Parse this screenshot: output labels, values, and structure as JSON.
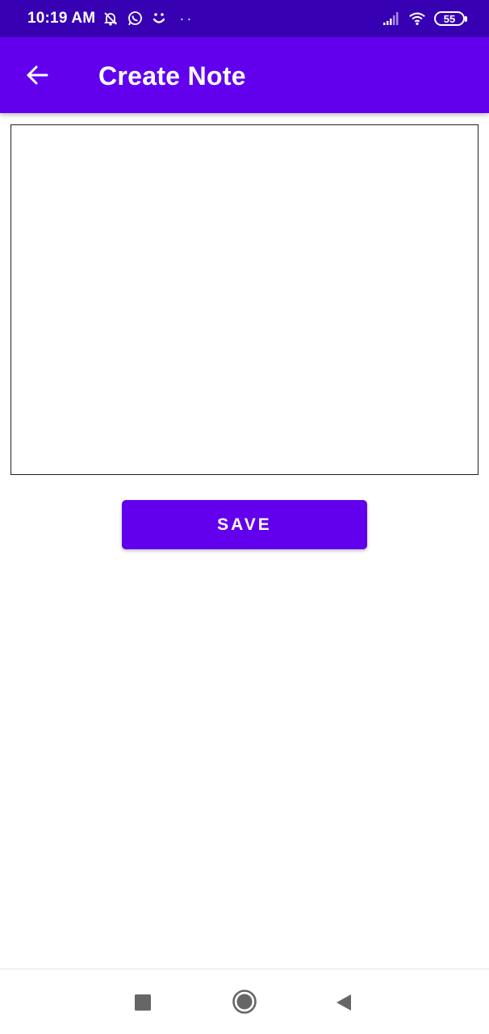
{
  "status_bar": {
    "time": "10:19 AM",
    "battery": "55",
    "icons": [
      "notifications-off-icon",
      "whatsapp-icon",
      "loading-icon",
      "more-dots-icon",
      "signal-icon",
      "wifi-icon",
      "battery-icon"
    ]
  },
  "app_bar": {
    "title": "Create Note",
    "back_icon": "arrow-left-icon"
  },
  "editor": {
    "value": "",
    "placeholder": ""
  },
  "actions": {
    "save_label": "SAVE"
  },
  "nav_bar": {
    "icons": [
      "recents-icon",
      "home-icon",
      "back-icon"
    ]
  },
  "colors": {
    "status_bar": "#3700b3",
    "primary": "#6200ee",
    "on_primary": "#ffffff",
    "background": "#ffffff",
    "nav_icon": "#666666"
  }
}
